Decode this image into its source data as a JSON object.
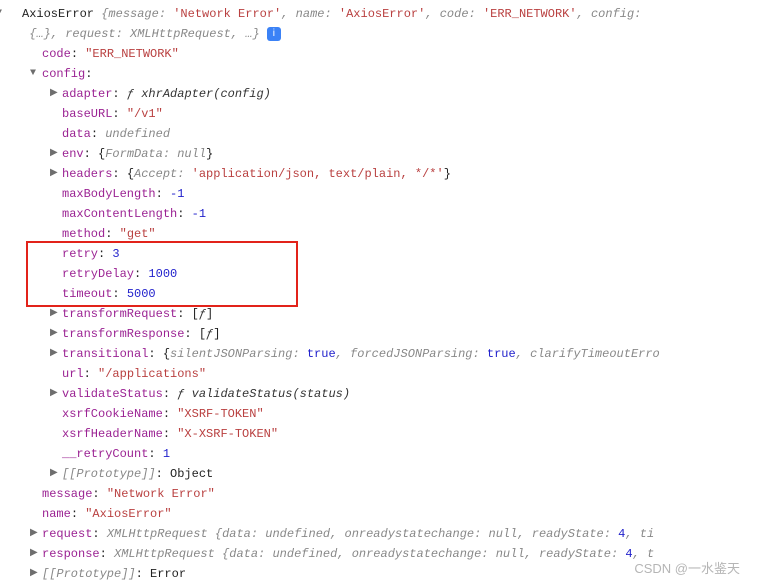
{
  "summary": {
    "classname": "AxiosError",
    "message_label": "message:",
    "message_value": "'Network Error'",
    "name_label": "name:",
    "name_value": "'AxiosError'",
    "code_label": "code:",
    "code_value": "'ERR_NETWORK'",
    "config_label": "config:",
    "config_value": "{…}",
    "request_label": "request:",
    "request_value": "XMLHttpRequest",
    "tail": ", …}"
  },
  "root": {
    "code": {
      "label": "code",
      "value": "\"ERR_NETWORK\""
    },
    "config_label": "config",
    "props": {
      "adapter": {
        "label": "adapter",
        "fn_sym": "ƒ",
        "fn_name": "xhrAdapter(config)"
      },
      "baseURL": {
        "label": "baseURL",
        "value": "\"/v1\""
      },
      "data": {
        "label": "data",
        "value": "undefined"
      },
      "env": {
        "label": "env",
        "open": "{",
        "k": "FormData:",
        "v": "null",
        "close": "}"
      },
      "headers": {
        "label": "headers",
        "open": "{",
        "k": "Accept:",
        "v": "'application/json, text/plain, */*'",
        "close": "}"
      },
      "maxBodyLength": {
        "label": "maxBodyLength",
        "value": "-1"
      },
      "maxContentLength": {
        "label": "maxContentLength",
        "value": "-1"
      },
      "method": {
        "label": "method",
        "value": "\"get\""
      },
      "retry": {
        "label": "retry",
        "value": "3"
      },
      "retryDelay": {
        "label": "retryDelay",
        "value": "1000"
      },
      "timeout": {
        "label": "timeout",
        "value": "5000"
      },
      "transformRequest": {
        "label": "transformRequest",
        "open": "[",
        "fn_sym": "ƒ",
        "close": "]"
      },
      "transformResponse": {
        "label": "transformResponse",
        "open": "[",
        "fn_sym": "ƒ",
        "close": "]"
      },
      "transitional": {
        "label": "transitional",
        "open": "{",
        "k1": "silentJSONParsing:",
        "v1": "true",
        "k2": "forcedJSONParsing:",
        "v2": "true",
        "k3": "clarifyTimeoutErro"
      },
      "url": {
        "label": "url",
        "value": "\"/applications\""
      },
      "validateStatus": {
        "label": "validateStatus",
        "fn_sym": "ƒ",
        "fn_name": "validateStatus(status)"
      },
      "xsrfCookieName": {
        "label": "xsrfCookieName",
        "value": "\"XSRF-TOKEN\""
      },
      "xsrfHeaderName": {
        "label": "xsrfHeaderName",
        "value": "\"X-XSRF-TOKEN\""
      },
      "retryCount": {
        "label": "__retryCount",
        "value": "1"
      },
      "proto": {
        "label": "[[Prototype]]",
        "value": "Object"
      }
    },
    "message": {
      "label": "message",
      "value": "\"Network Error\""
    },
    "name": {
      "label": "name",
      "value": "\"AxiosError\""
    },
    "request": {
      "label": "request",
      "classname": "XMLHttpRequest",
      "open": "{",
      "k1": "data:",
      "v1": "undefined",
      "k2": "onreadystatechange:",
      "v2": "null",
      "k3": "readyState:",
      "v3": "4",
      "tail": ", ti"
    },
    "response": {
      "label": "response",
      "classname": "XMLHttpRequest",
      "open": "{",
      "k1": "data:",
      "v1": "undefined",
      "k2": "onreadystatechange:",
      "v2": "null",
      "k3": "readyState:",
      "v3": "4",
      "tail": ", t"
    },
    "proto": {
      "label": "[[Prototype]]",
      "value": "Error"
    }
  },
  "watermark": "CSDN @一水鉴天"
}
